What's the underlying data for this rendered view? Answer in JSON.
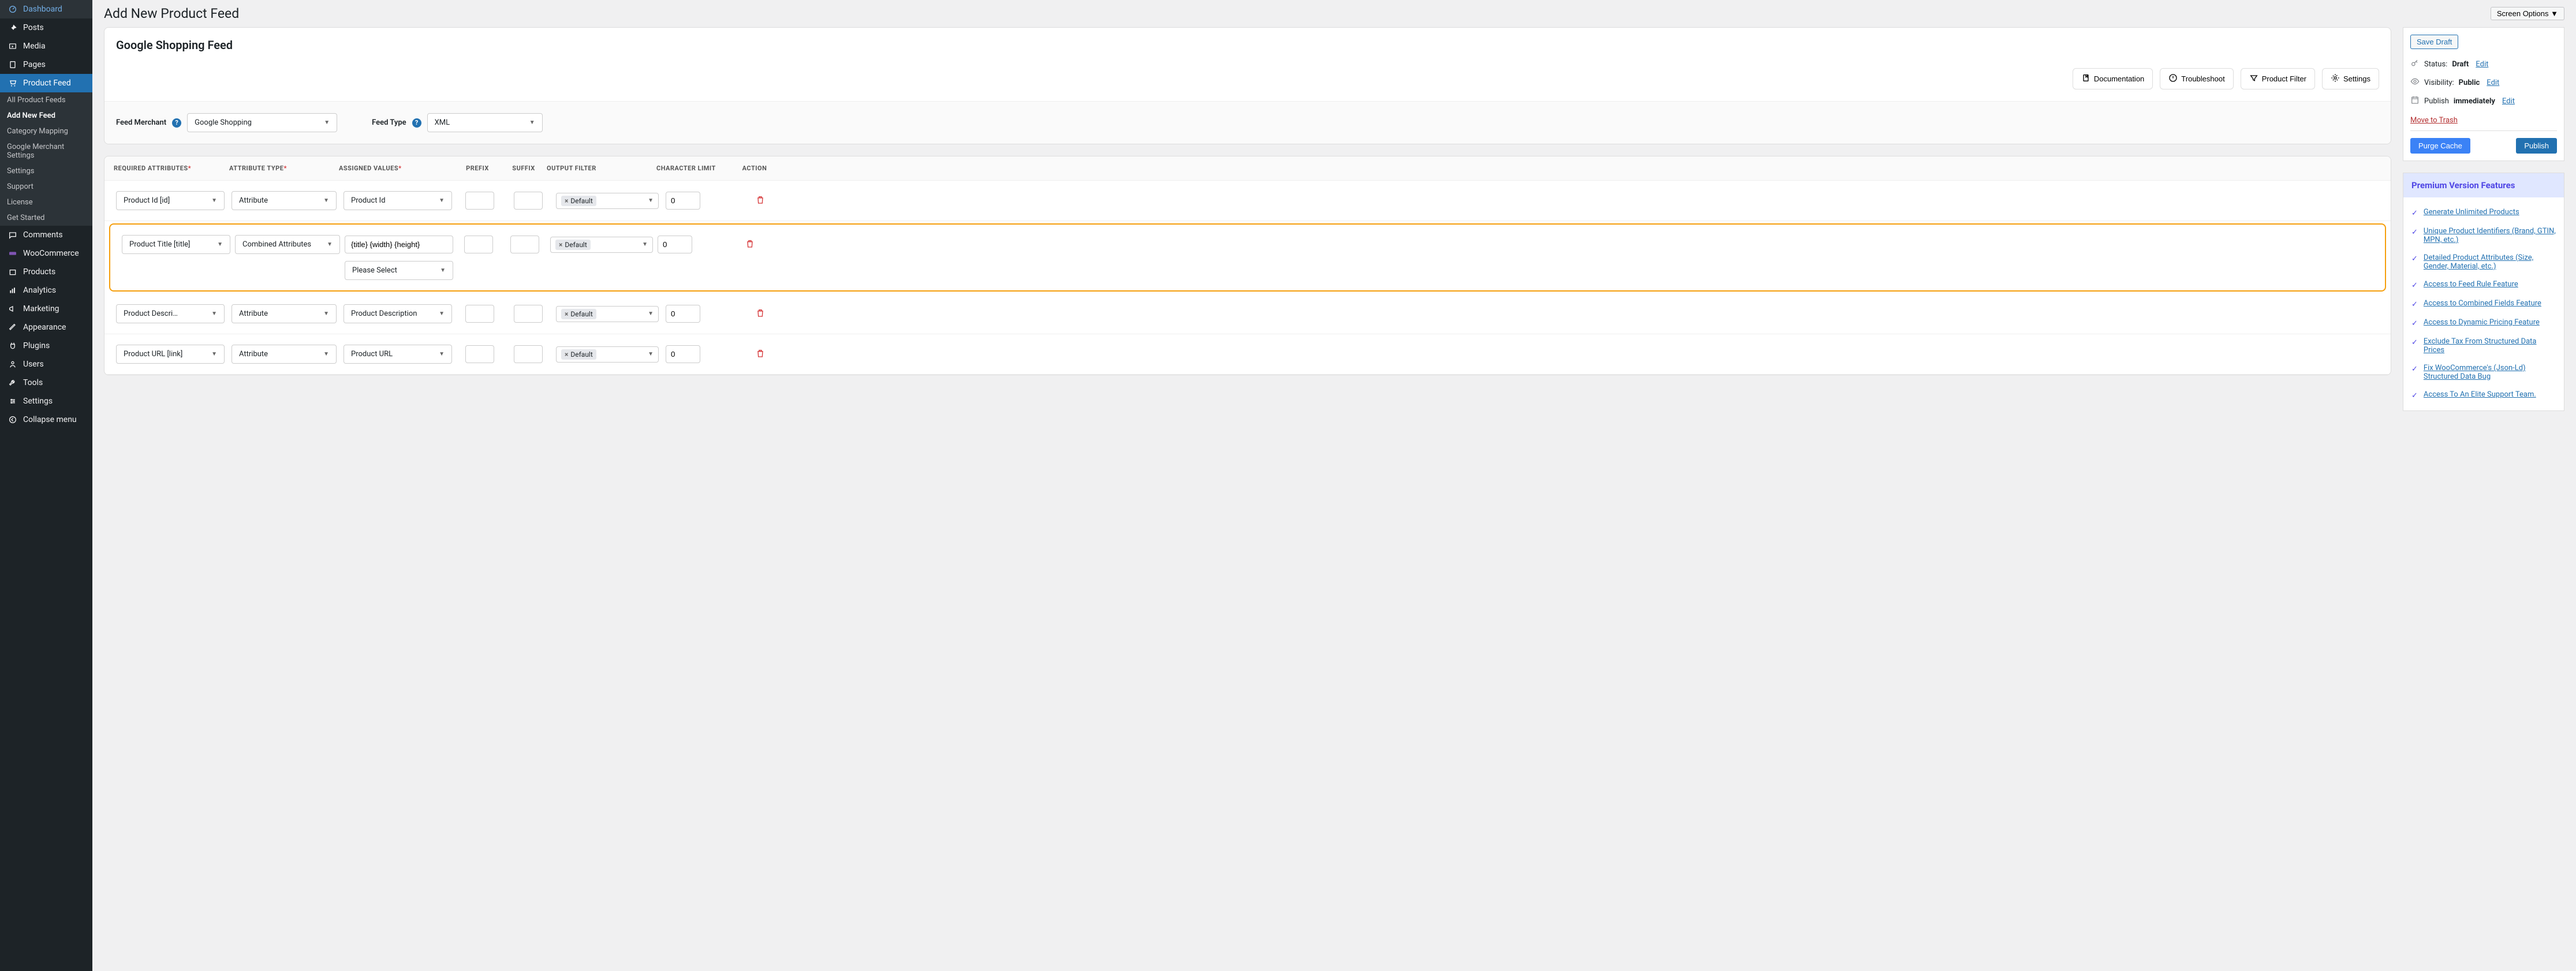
{
  "screen_options": "Screen Options",
  "page_title": "Add New Product Feed",
  "sidebar": {
    "items": [
      {
        "label": "Dashboard"
      },
      {
        "label": "Posts"
      },
      {
        "label": "Media"
      },
      {
        "label": "Pages"
      },
      {
        "label": "Product Feed"
      },
      {
        "label": "Comments"
      },
      {
        "label": "WooCommerce"
      },
      {
        "label": "Products"
      },
      {
        "label": "Analytics"
      },
      {
        "label": "Marketing"
      },
      {
        "label": "Appearance"
      },
      {
        "label": "Plugins"
      },
      {
        "label": "Users"
      },
      {
        "label": "Tools"
      },
      {
        "label": "Settings"
      },
      {
        "label": "Collapse menu"
      }
    ],
    "subitems": [
      "All Product Feeds",
      "Add New Feed",
      "Category Mapping",
      "Google Merchant Settings",
      "Settings",
      "Support",
      "License",
      "Get Started"
    ]
  },
  "feed": {
    "title": "Google Shopping Feed",
    "actions": {
      "documentation": "Documentation",
      "troubleshoot": "Troubleshoot",
      "product_filter": "Product Filter",
      "settings": "Settings"
    },
    "merchant_label": "Feed Merchant",
    "merchant_value": "Google Shopping",
    "type_label": "Feed Type",
    "type_value": "XML"
  },
  "table": {
    "headers": {
      "required": "REQUIRED ATTRIBUTES",
      "type": "ATTRIBUTE TYPE",
      "values": "ASSIGNED VALUES",
      "prefix": "PREFIX",
      "suffix": "SUFFIX",
      "filter": "OUTPUT FILTER",
      "limit": "CHARACTER LIMIT",
      "action": "ACTION"
    },
    "rows": [
      {
        "required": "Product Id [id]",
        "type": "Attribute",
        "value": "Product Id",
        "prefix": "",
        "suffix": "",
        "filter": "Default",
        "limit": "0"
      },
      {
        "required": "Product Title [title]",
        "type": "Combined Attributes",
        "value": "{title} {width} {height}",
        "prefix": "",
        "suffix": "",
        "filter": "Default",
        "limit": "0",
        "highlighted": true,
        "extra_select": "Please Select"
      },
      {
        "required": "Product Description [description]",
        "type": "Attribute",
        "value": "Product Description",
        "prefix": "",
        "suffix": "",
        "filter": "Default",
        "limit": "0"
      },
      {
        "required": "Product URL [link]",
        "type": "Attribute",
        "value": "Product URL",
        "prefix": "",
        "suffix": "",
        "filter": "Default",
        "limit": "0"
      }
    ]
  },
  "publish": {
    "save_draft": "Save Draft",
    "status_label": "Status:",
    "status_value": "Draft",
    "visibility_label": "Visibility:",
    "visibility_value": "Public",
    "publish_label": "Publish",
    "publish_value": "immediately",
    "edit": "Edit",
    "trash": "Move to Trash",
    "purge": "Purge Cache",
    "publish_btn": "Publish"
  },
  "premium": {
    "title": "Premium Version Features",
    "items": [
      "Generate Unlimited Products",
      "Unique Product Identifiers (Brand, GTIN, MPN, etc.)",
      "Detailed Product Attributes (Size, Gender, Material, etc.)",
      "Access to Feed Rule Feature",
      "Access to Combined Fields Feature",
      "Access to Dynamic Pricing Feature",
      "Exclude Tax From Structured Data Prices",
      "Fix WooCommerce's (Json-Ld) Structured Data Bug",
      "Access To An Elite Support Team."
    ]
  }
}
